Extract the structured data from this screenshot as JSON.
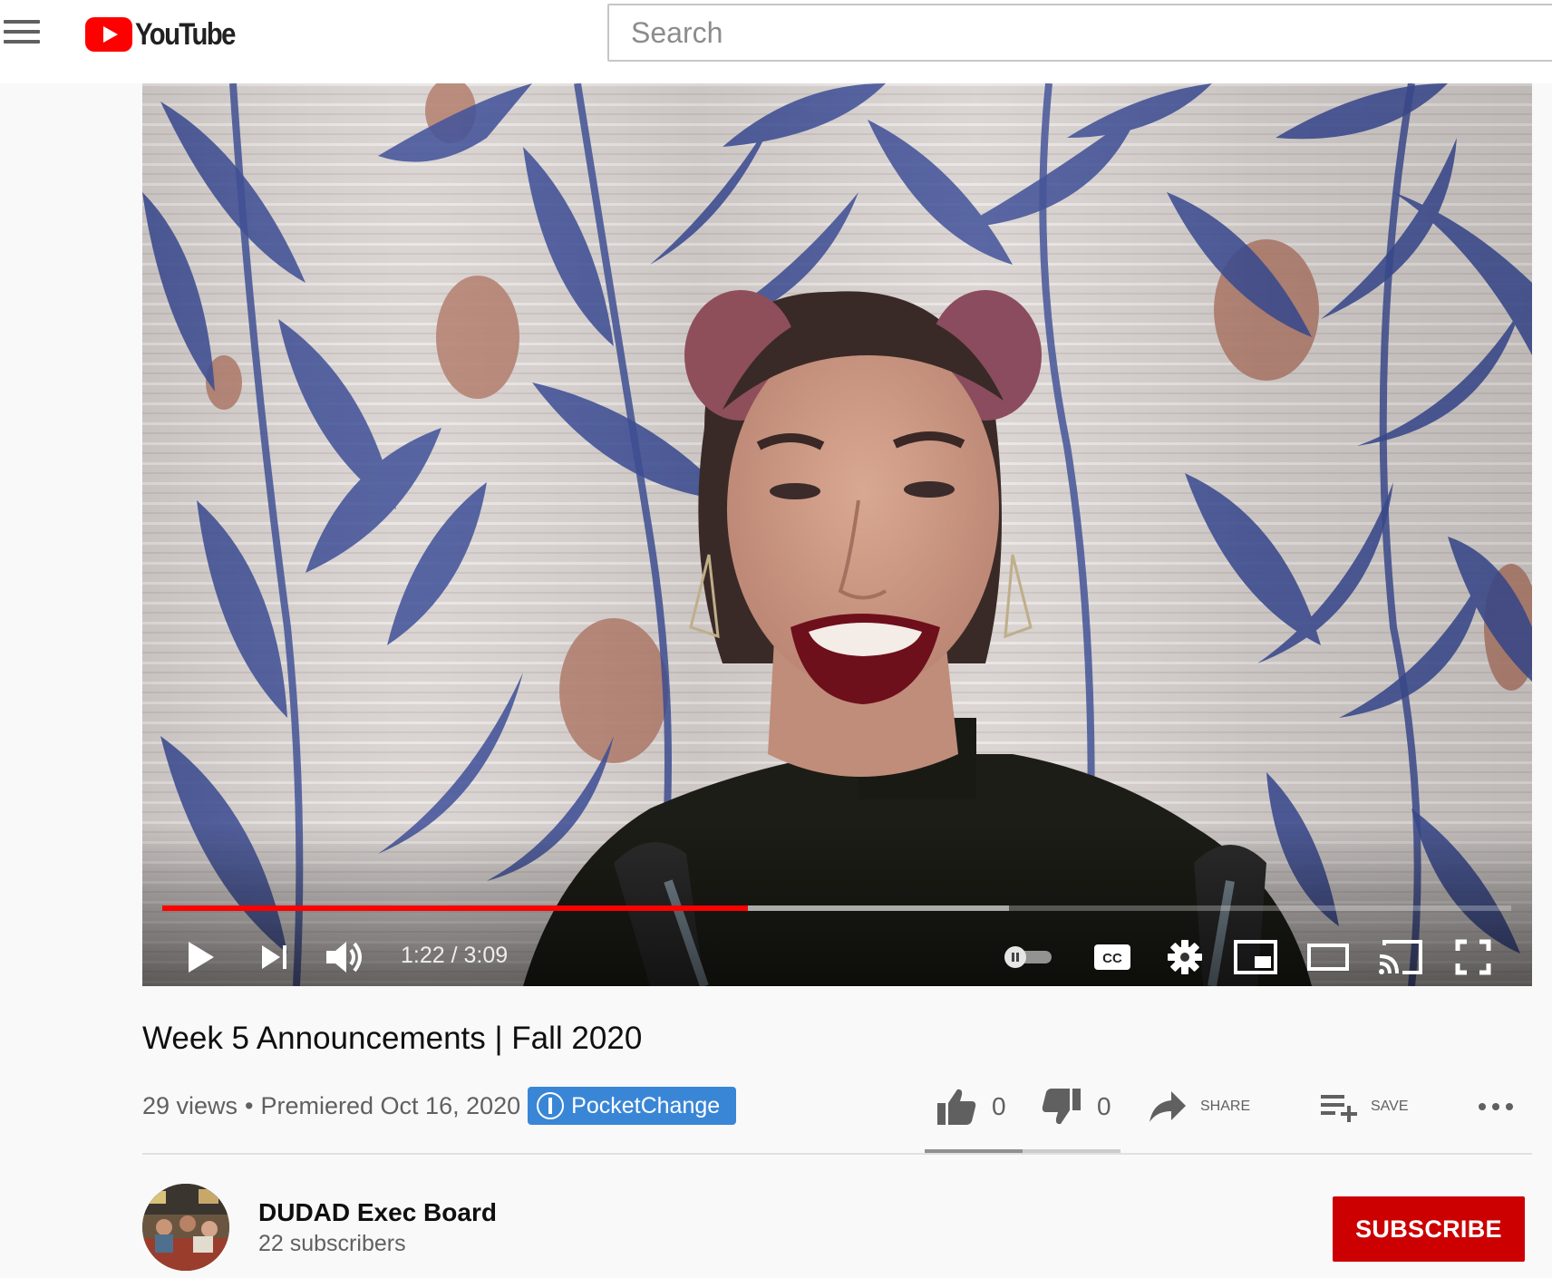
{
  "masthead": {
    "logo_text": "YouTube",
    "search_placeholder": "Search"
  },
  "player": {
    "current_time": "1:22",
    "duration": "3:09",
    "time_display": "1:22 / 3:09",
    "progress_played": 0.434,
    "progress_buffered": 0.628,
    "cc_label": "CC",
    "icons": [
      "play-icon",
      "next-icon",
      "volume-icon",
      "autoplay-toggle-icon",
      "cc-icon",
      "settings-icon",
      "miniplayer-icon",
      "theater-icon",
      "cast-icon",
      "fullscreen-icon"
    ]
  },
  "video": {
    "title": "Week 5 Announcements | Fall 2020",
    "views": "29 views",
    "separator": "•",
    "premiered": "Premiered Oct 16, 2020",
    "badge": "PocketChange"
  },
  "actions": {
    "likes": "0",
    "dislikes": "0",
    "share_label": "SHARE",
    "save_label": "SAVE",
    "like_ratio": 0.5
  },
  "channel": {
    "name": "DUDAD Exec Board",
    "subscribers": "22 subscribers",
    "subscribe_label": "SUBSCRIBE"
  },
  "colors": {
    "brand_red": "#ff0000",
    "subscribe_red": "#cc0000",
    "badge_blue": "#3a86d6",
    "curtain_blue": "#3e4f97",
    "curtain_dot": "#b4806f"
  }
}
